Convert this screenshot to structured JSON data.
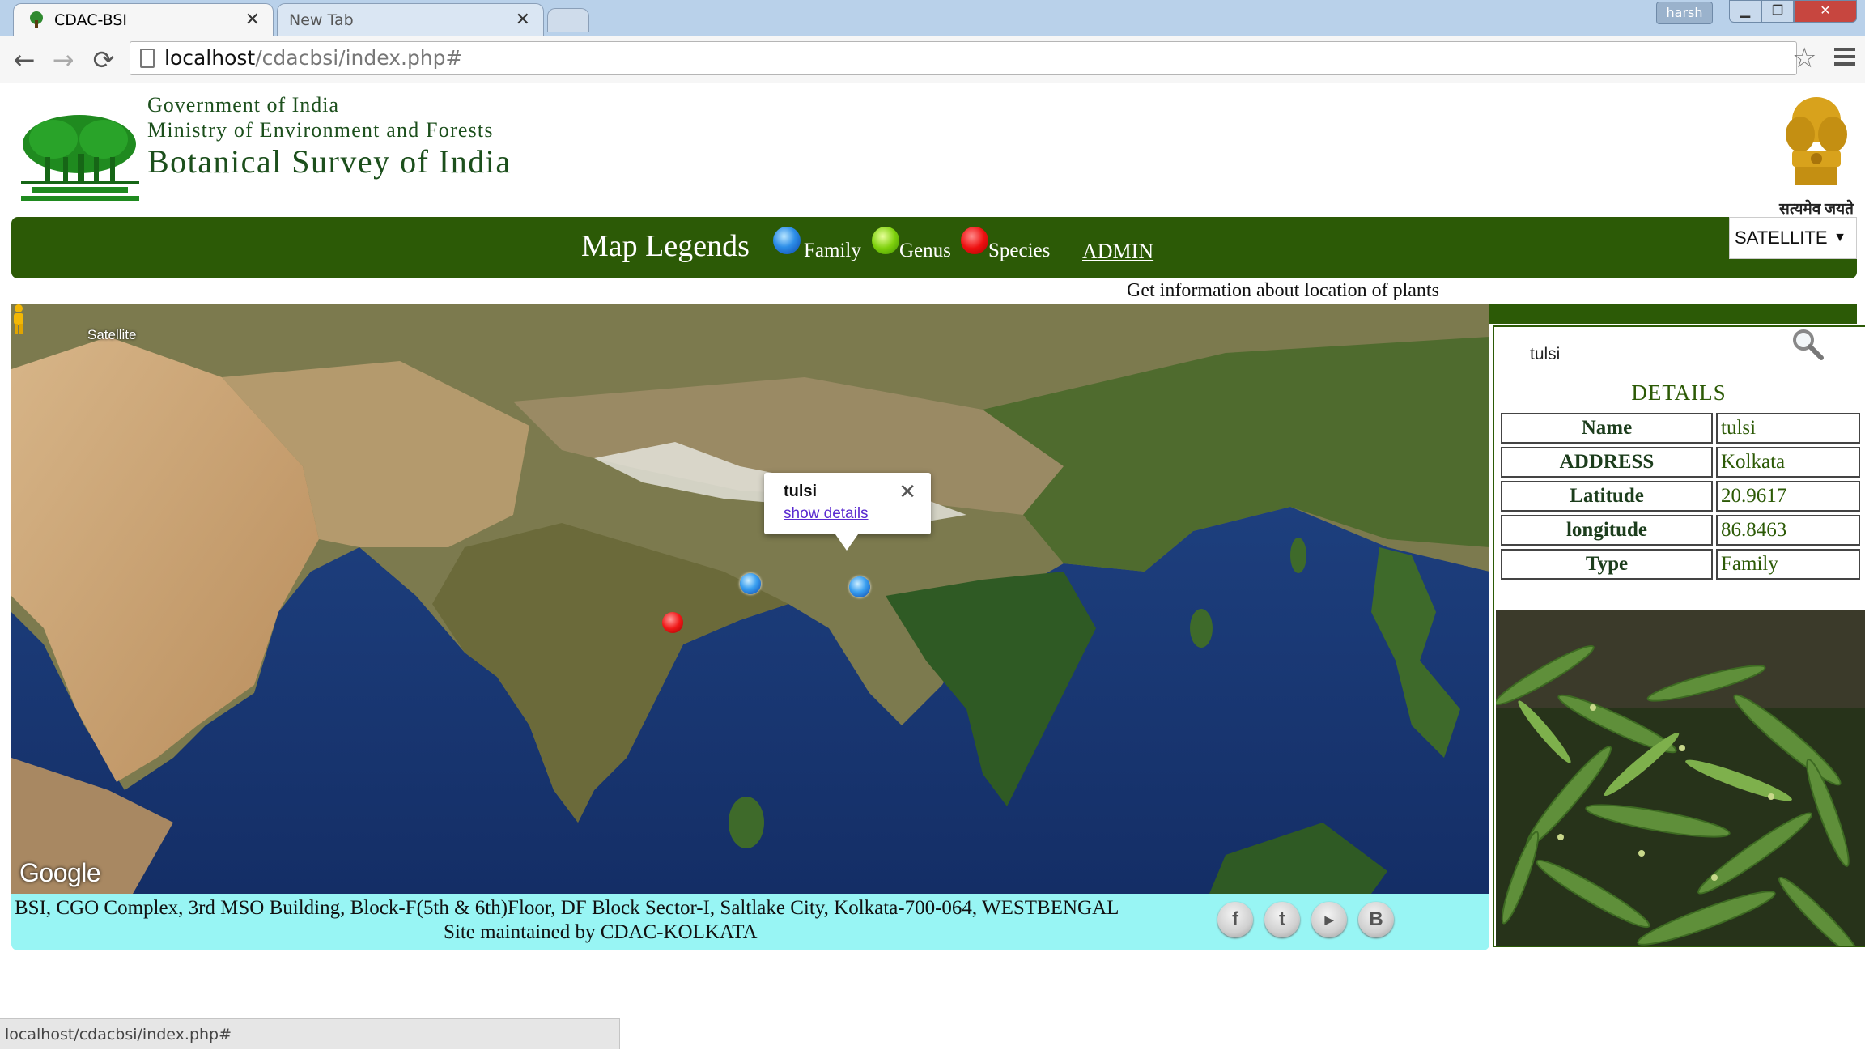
{
  "browser": {
    "tabs": [
      {
        "label": "CDAC-BSI",
        "active": true
      },
      {
        "label": "New Tab",
        "active": false
      }
    ],
    "profile": "harsh",
    "url_host": "localhost",
    "url_path": "/cdacbsi/index.php#",
    "status_url": "localhost/cdacbsi/index.php#"
  },
  "header": {
    "line1": "Government of India",
    "line2": "Ministry of Environment and Forests",
    "title": "Botanical Survey of India",
    "emblem_motto": "सत्यमेव जयते"
  },
  "nav": {
    "map_legends": "Map Legends",
    "legend": [
      {
        "label": "Family",
        "color": "#2d8ee8"
      },
      {
        "label": "Genus",
        "color": "#7fd10d"
      },
      {
        "label": "Species",
        "color": "#ee1111"
      }
    ],
    "admin": "ADMIN",
    "map_type": "SATELLITE"
  },
  "tagline": "Get information about location of plants",
  "map": {
    "satellite_label": "Satellite",
    "google": "Google",
    "popup": {
      "title": "tulsi",
      "link": "show details"
    }
  },
  "panel": {
    "search_value": "tulsi",
    "details_heading": "DETAILS",
    "rows": [
      {
        "key": "Name",
        "value": "tulsi"
      },
      {
        "key": "ADDRESS",
        "value": "Kolkata"
      },
      {
        "key": "Latitude",
        "value": "20.9617"
      },
      {
        "key": "longitude",
        "value": "86.8463"
      },
      {
        "key": "Type",
        "value": "Family"
      }
    ]
  },
  "footer": {
    "address": "BSI, CGO Complex, 3rd MSO Building, Block-F(5th & 6th)Floor, DF Block Sector-I, Saltlake City, Kolkata-700-064, WESTBENGAL",
    "maintained": "Site maintained by CDAC-KOLKATA"
  },
  "colors": {
    "nav_green": "#2c5a06",
    "footer_cyan": "#98f5f4",
    "header_text": "#1c4f1c"
  }
}
